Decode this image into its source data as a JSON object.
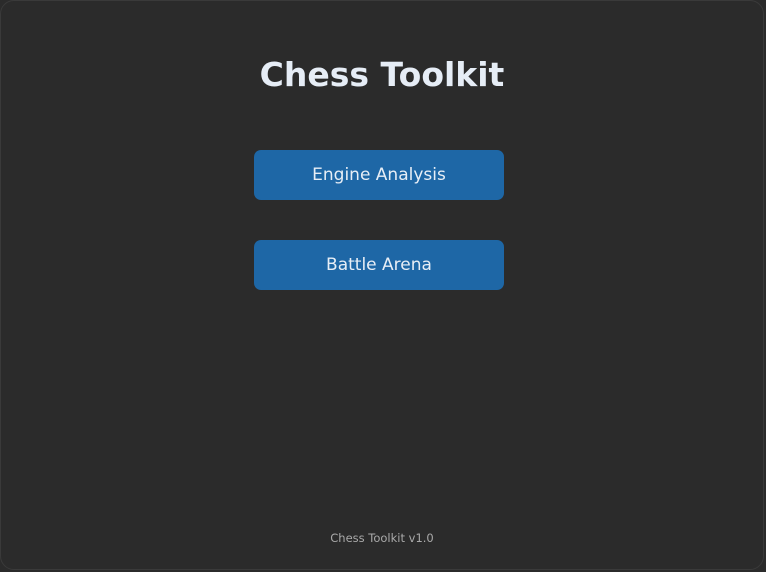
{
  "app": {
    "title": "Chess Toolkit"
  },
  "menu": {
    "buttons": [
      {
        "label": "Engine Analysis"
      },
      {
        "label": "Battle Arena"
      }
    ]
  },
  "footer": {
    "version_text": "Chess Toolkit v1.0"
  },
  "colors": {
    "background": "#2b2b2b",
    "button": "#1e67a6",
    "title_text": "#e6edf6",
    "footer_text": "#a9a9a9"
  }
}
